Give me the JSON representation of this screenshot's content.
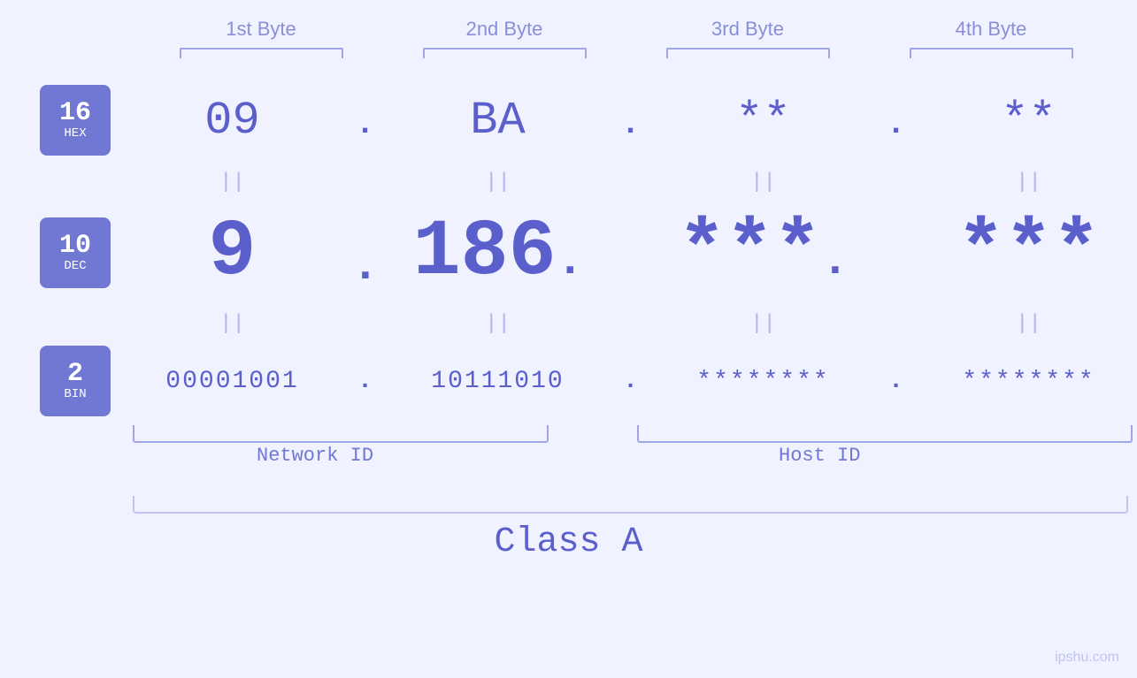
{
  "headers": {
    "byte1": "1st Byte",
    "byte2": "2nd Byte",
    "byte3": "3rd Byte",
    "byte4": "4th Byte"
  },
  "badges": {
    "hex": {
      "number": "16",
      "label": "HEX"
    },
    "dec": {
      "number": "10",
      "label": "DEC"
    },
    "bin": {
      "number": "2",
      "label": "BIN"
    }
  },
  "rows": {
    "hex": {
      "b1": "09",
      "b2": "BA",
      "b3": "**",
      "b4": "**"
    },
    "dec": {
      "b1": "9",
      "b2": "186.",
      "b3": "***.",
      "b4": "***"
    },
    "bin": {
      "b1": "00001001",
      "b2": "10111010",
      "b3": "********",
      "b4": "********"
    }
  },
  "labels": {
    "network_id": "Network ID",
    "host_id": "Host ID",
    "class": "Class A"
  },
  "watermark": "ipshu.com",
  "equals": "||"
}
